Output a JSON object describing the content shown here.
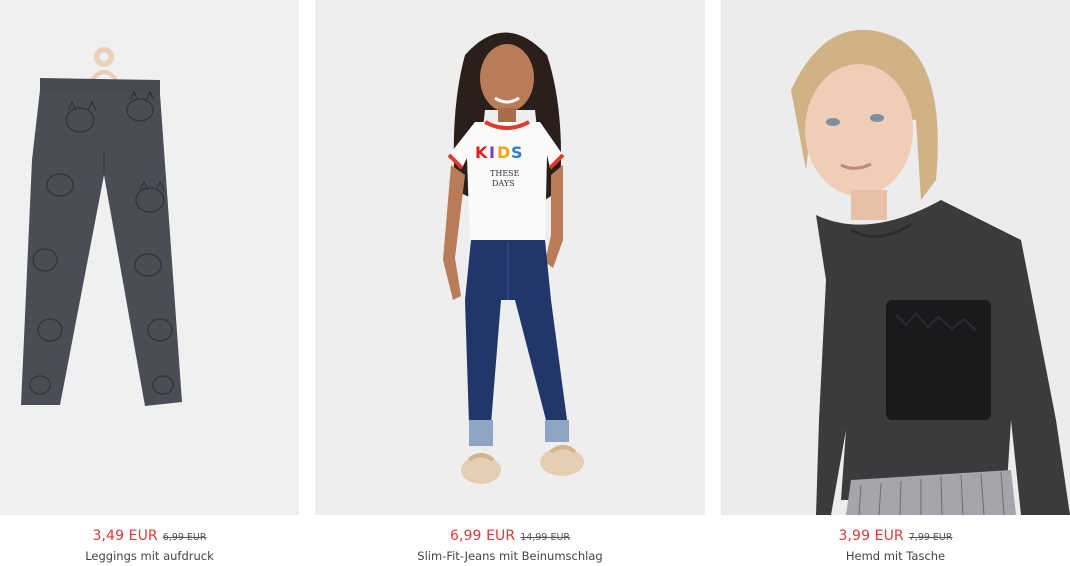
{
  "products": [
    {
      "price": "3,49 EUR",
      "old_price": "6,99 EUR",
      "name": "Leggings mit aufdruck"
    },
    {
      "price": "6,99 EUR",
      "old_price": "14,99 EUR",
      "name": "Slim-Fit-Jeans mit Beinumschlag"
    },
    {
      "price": "3,99 EUR",
      "old_price": "7,99 EUR",
      "name": "Hemd mit Tasche"
    }
  ],
  "colors": {
    "sale_price": "#e5383b",
    "old_price": "#555555",
    "name": "#444444",
    "photo_bg": "#f0f0f0"
  }
}
